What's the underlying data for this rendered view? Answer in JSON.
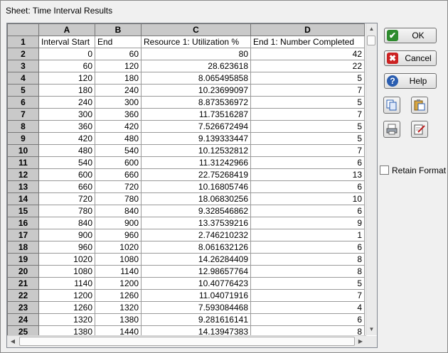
{
  "window": {
    "title": "Sheet: Time Interval Results"
  },
  "sheet": {
    "column_letters": [
      "A",
      "B",
      "C",
      "D"
    ],
    "rows": [
      {
        "n": "1",
        "a": "Interval Start",
        "b": "End",
        "c": "Resource 1: Utilization %",
        "d": "End 1: Number Completed"
      },
      {
        "n": "2",
        "a": "0",
        "b": "60",
        "c": "80",
        "d": "42"
      },
      {
        "n": "3",
        "a": "60",
        "b": "120",
        "c": "28.623618",
        "d": "22"
      },
      {
        "n": "4",
        "a": "120",
        "b": "180",
        "c": "8.065495858",
        "d": "5"
      },
      {
        "n": "5",
        "a": "180",
        "b": "240",
        "c": "10.23699097",
        "d": "7"
      },
      {
        "n": "6",
        "a": "240",
        "b": "300",
        "c": "8.873536972",
        "d": "5"
      },
      {
        "n": "7",
        "a": "300",
        "b": "360",
        "c": "11.73516287",
        "d": "7"
      },
      {
        "n": "8",
        "a": "360",
        "b": "420",
        "c": "7.526672494",
        "d": "5"
      },
      {
        "n": "9",
        "a": "420",
        "b": "480",
        "c": "9.139333447",
        "d": "5"
      },
      {
        "n": "10",
        "a": "480",
        "b": "540",
        "c": "10.12532812",
        "d": "7"
      },
      {
        "n": "11",
        "a": "540",
        "b": "600",
        "c": "11.31242966",
        "d": "6"
      },
      {
        "n": "12",
        "a": "600",
        "b": "660",
        "c": "22.75268419",
        "d": "13"
      },
      {
        "n": "13",
        "a": "660",
        "b": "720",
        "c": "10.16805746",
        "d": "6"
      },
      {
        "n": "14",
        "a": "720",
        "b": "780",
        "c": "18.06830256",
        "d": "10"
      },
      {
        "n": "15",
        "a": "780",
        "b": "840",
        "c": "9.328546862",
        "d": "6"
      },
      {
        "n": "16",
        "a": "840",
        "b": "900",
        "c": "13.37539216",
        "d": "9"
      },
      {
        "n": "17",
        "a": "900",
        "b": "960",
        "c": "2.746210232",
        "d": "1"
      },
      {
        "n": "18",
        "a": "960",
        "b": "1020",
        "c": "8.061632126",
        "d": "6"
      },
      {
        "n": "19",
        "a": "1020",
        "b": "1080",
        "c": "14.26284409",
        "d": "8"
      },
      {
        "n": "20",
        "a": "1080",
        "b": "1140",
        "c": "12.98657764",
        "d": "8"
      },
      {
        "n": "21",
        "a": "1140",
        "b": "1200",
        "c": "10.40776423",
        "d": "5"
      },
      {
        "n": "22",
        "a": "1200",
        "b": "1260",
        "c": "11.04071916",
        "d": "7"
      },
      {
        "n": "23",
        "a": "1260",
        "b": "1320",
        "c": "7.593084468",
        "d": "4"
      },
      {
        "n": "24",
        "a": "1320",
        "b": "1380",
        "c": "9.281616141",
        "d": "6"
      },
      {
        "n": "25",
        "a": "1380",
        "b": "1440",
        "c": "14.13947383",
        "d": "8"
      }
    ]
  },
  "buttons": {
    "ok": "OK",
    "cancel": "Cancel",
    "help": "Help"
  },
  "icons": {
    "copy": "copy-icon",
    "paste": "paste-icon",
    "print": "print-icon",
    "edit": "edit-icon"
  },
  "retain_format": {
    "label": "Retain Format",
    "checked": false
  },
  "colors": {
    "ok_green": "#2e8b2e",
    "cancel_red": "#cc2222",
    "help_blue": "#2a5db0",
    "header_gray": "#c9c9c9"
  }
}
